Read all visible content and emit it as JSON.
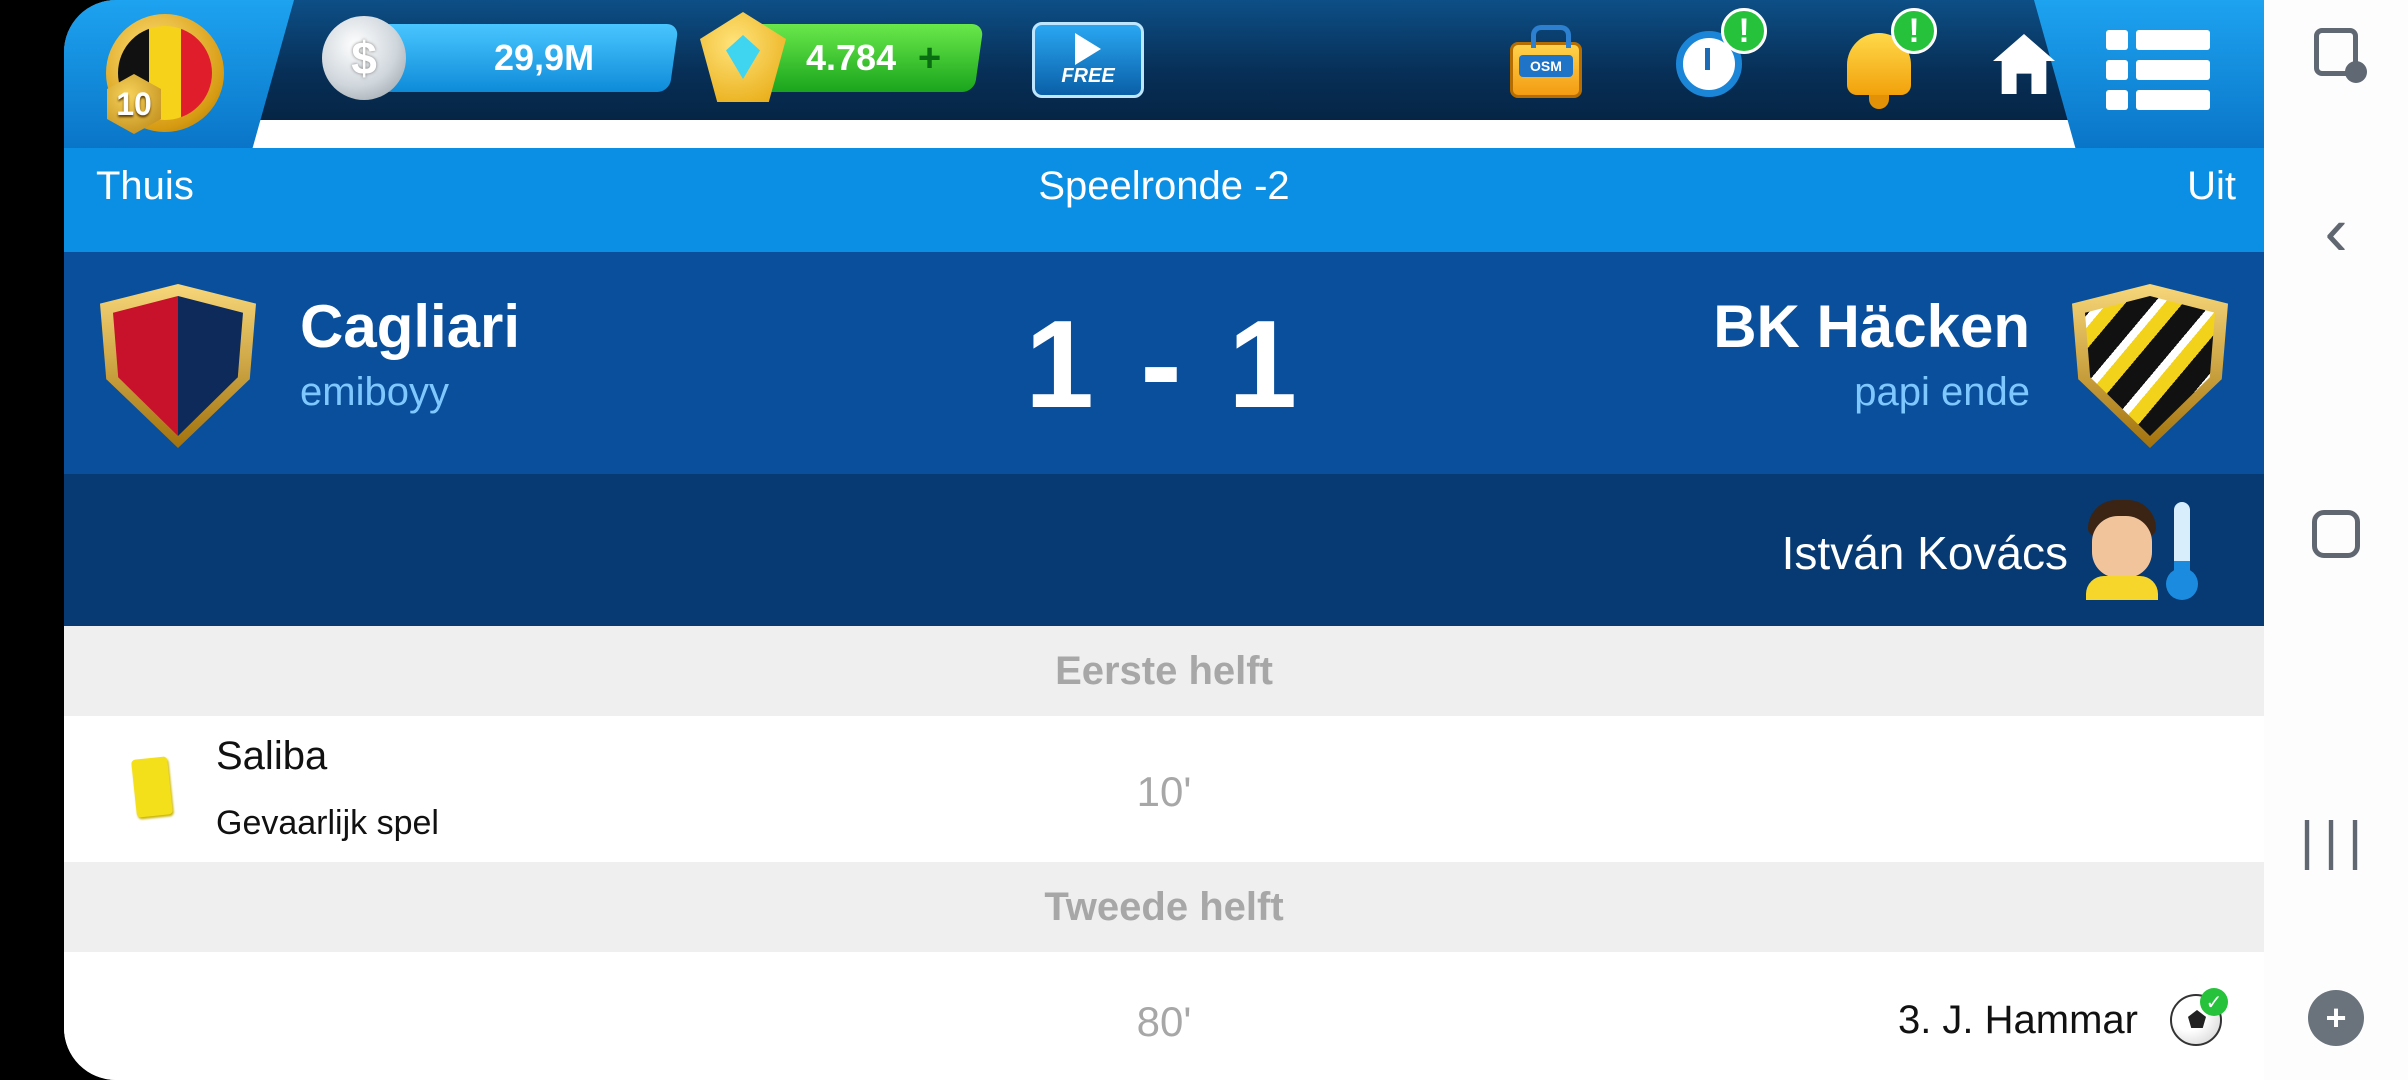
{
  "topbar": {
    "level": "10",
    "coins": "29,9M",
    "gems": "4.784",
    "gems_plus_icon": "+",
    "free_video_label": "FREE",
    "bag_label": "OSM",
    "alert_mark": "!",
    "icons": [
      "belgium-flag-badge",
      "silver-coin-icon",
      "gem-icon",
      "free-video-icon",
      "osm-bag-icon",
      "stopwatch-icon",
      "bell-icon",
      "home-icon",
      "menu-icon"
    ]
  },
  "round": {
    "home_label": "Thuis",
    "title": "Speelronde -2",
    "away_label": "Uit"
  },
  "match": {
    "home_team": "Cagliari",
    "home_manager": "emiboyy",
    "score": "1 - 1",
    "away_team": "BK Häcken",
    "away_manager": "papi ende"
  },
  "referee": {
    "name": "István Kovács",
    "strictness_level": 0.25
  },
  "events": {
    "first_half_label": "Eerste helft",
    "second_half_label": "Tweede helft",
    "list": [
      {
        "minute": "10'",
        "player": "Saliba",
        "detail": "Gevaarlijk spel",
        "type": "yellow-card",
        "side": "home"
      },
      {
        "minute": "80'",
        "player": "3. J. Hammar",
        "type": "goal",
        "side": "away"
      }
    ]
  },
  "android_nav": {
    "back_glyph": "‹",
    "recent_glyph": "|||",
    "game_glyph": "+"
  },
  "colors": {
    "topbar": "#072f57",
    "round_bar": "#0a8fe4",
    "match_row": "#0a4f9c",
    "referee_row": "#073a72",
    "half_header": "#efefef",
    "yellow_card": "#f3df1a",
    "manager_text": "#7ec8ff"
  }
}
